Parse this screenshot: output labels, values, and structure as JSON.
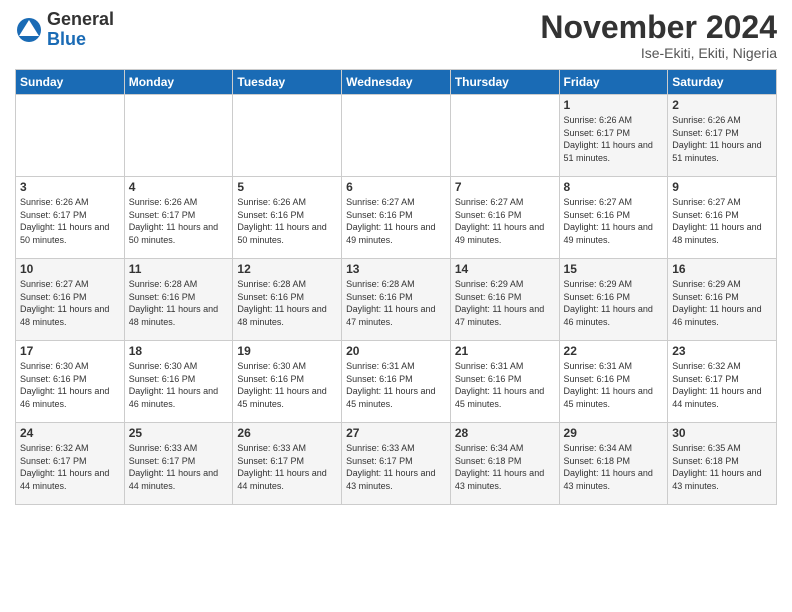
{
  "logo": {
    "general": "General",
    "blue": "Blue"
  },
  "header": {
    "month_title": "November 2024",
    "subtitle": "Ise-Ekiti, Ekiti, Nigeria"
  },
  "weekdays": [
    "Sunday",
    "Monday",
    "Tuesday",
    "Wednesday",
    "Thursday",
    "Friday",
    "Saturday"
  ],
  "weeks": [
    [
      {
        "day": "",
        "info": ""
      },
      {
        "day": "",
        "info": ""
      },
      {
        "day": "",
        "info": ""
      },
      {
        "day": "",
        "info": ""
      },
      {
        "day": "",
        "info": ""
      },
      {
        "day": "1",
        "info": "Sunrise: 6:26 AM\nSunset: 6:17 PM\nDaylight: 11 hours and 51 minutes."
      },
      {
        "day": "2",
        "info": "Sunrise: 6:26 AM\nSunset: 6:17 PM\nDaylight: 11 hours and 51 minutes."
      }
    ],
    [
      {
        "day": "3",
        "info": "Sunrise: 6:26 AM\nSunset: 6:17 PM\nDaylight: 11 hours and 50 minutes."
      },
      {
        "day": "4",
        "info": "Sunrise: 6:26 AM\nSunset: 6:17 PM\nDaylight: 11 hours and 50 minutes."
      },
      {
        "day": "5",
        "info": "Sunrise: 6:26 AM\nSunset: 6:16 PM\nDaylight: 11 hours and 50 minutes."
      },
      {
        "day": "6",
        "info": "Sunrise: 6:27 AM\nSunset: 6:16 PM\nDaylight: 11 hours and 49 minutes."
      },
      {
        "day": "7",
        "info": "Sunrise: 6:27 AM\nSunset: 6:16 PM\nDaylight: 11 hours and 49 minutes."
      },
      {
        "day": "8",
        "info": "Sunrise: 6:27 AM\nSunset: 6:16 PM\nDaylight: 11 hours and 49 minutes."
      },
      {
        "day": "9",
        "info": "Sunrise: 6:27 AM\nSunset: 6:16 PM\nDaylight: 11 hours and 48 minutes."
      }
    ],
    [
      {
        "day": "10",
        "info": "Sunrise: 6:27 AM\nSunset: 6:16 PM\nDaylight: 11 hours and 48 minutes."
      },
      {
        "day": "11",
        "info": "Sunrise: 6:28 AM\nSunset: 6:16 PM\nDaylight: 11 hours and 48 minutes."
      },
      {
        "day": "12",
        "info": "Sunrise: 6:28 AM\nSunset: 6:16 PM\nDaylight: 11 hours and 48 minutes."
      },
      {
        "day": "13",
        "info": "Sunrise: 6:28 AM\nSunset: 6:16 PM\nDaylight: 11 hours and 47 minutes."
      },
      {
        "day": "14",
        "info": "Sunrise: 6:29 AM\nSunset: 6:16 PM\nDaylight: 11 hours and 47 minutes."
      },
      {
        "day": "15",
        "info": "Sunrise: 6:29 AM\nSunset: 6:16 PM\nDaylight: 11 hours and 46 minutes."
      },
      {
        "day": "16",
        "info": "Sunrise: 6:29 AM\nSunset: 6:16 PM\nDaylight: 11 hours and 46 minutes."
      }
    ],
    [
      {
        "day": "17",
        "info": "Sunrise: 6:30 AM\nSunset: 6:16 PM\nDaylight: 11 hours and 46 minutes."
      },
      {
        "day": "18",
        "info": "Sunrise: 6:30 AM\nSunset: 6:16 PM\nDaylight: 11 hours and 46 minutes."
      },
      {
        "day": "19",
        "info": "Sunrise: 6:30 AM\nSunset: 6:16 PM\nDaylight: 11 hours and 45 minutes."
      },
      {
        "day": "20",
        "info": "Sunrise: 6:31 AM\nSunset: 6:16 PM\nDaylight: 11 hours and 45 minutes."
      },
      {
        "day": "21",
        "info": "Sunrise: 6:31 AM\nSunset: 6:16 PM\nDaylight: 11 hours and 45 minutes."
      },
      {
        "day": "22",
        "info": "Sunrise: 6:31 AM\nSunset: 6:16 PM\nDaylight: 11 hours and 45 minutes."
      },
      {
        "day": "23",
        "info": "Sunrise: 6:32 AM\nSunset: 6:17 PM\nDaylight: 11 hours and 44 minutes."
      }
    ],
    [
      {
        "day": "24",
        "info": "Sunrise: 6:32 AM\nSunset: 6:17 PM\nDaylight: 11 hours and 44 minutes."
      },
      {
        "day": "25",
        "info": "Sunrise: 6:33 AM\nSunset: 6:17 PM\nDaylight: 11 hours and 44 minutes."
      },
      {
        "day": "26",
        "info": "Sunrise: 6:33 AM\nSunset: 6:17 PM\nDaylight: 11 hours and 44 minutes."
      },
      {
        "day": "27",
        "info": "Sunrise: 6:33 AM\nSunset: 6:17 PM\nDaylight: 11 hours and 43 minutes."
      },
      {
        "day": "28",
        "info": "Sunrise: 6:34 AM\nSunset: 6:18 PM\nDaylight: 11 hours and 43 minutes."
      },
      {
        "day": "29",
        "info": "Sunrise: 6:34 AM\nSunset: 6:18 PM\nDaylight: 11 hours and 43 minutes."
      },
      {
        "day": "30",
        "info": "Sunrise: 6:35 AM\nSunset: 6:18 PM\nDaylight: 11 hours and 43 minutes."
      }
    ]
  ]
}
